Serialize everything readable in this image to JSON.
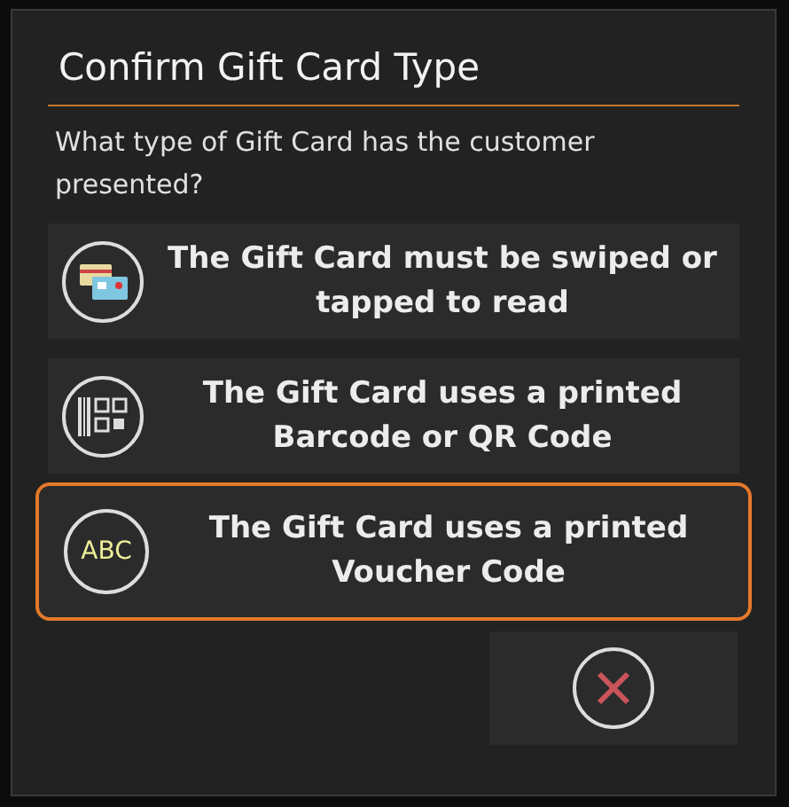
{
  "dialog": {
    "title": "Confirm Gift Card Type",
    "question": "What type of Gift Card has the customer presented?",
    "options": [
      {
        "kind": "card",
        "label": "The Gift Card must be swiped or tapped to read",
        "selected": false
      },
      {
        "kind": "barcode",
        "label": "The Gift Card uses a printed Barcode or QR Code",
        "selected": false
      },
      {
        "kind": "text",
        "icon_text": "ABC",
        "label": "The Gift Card uses a printed Voucher Code",
        "selected": true
      }
    ]
  }
}
